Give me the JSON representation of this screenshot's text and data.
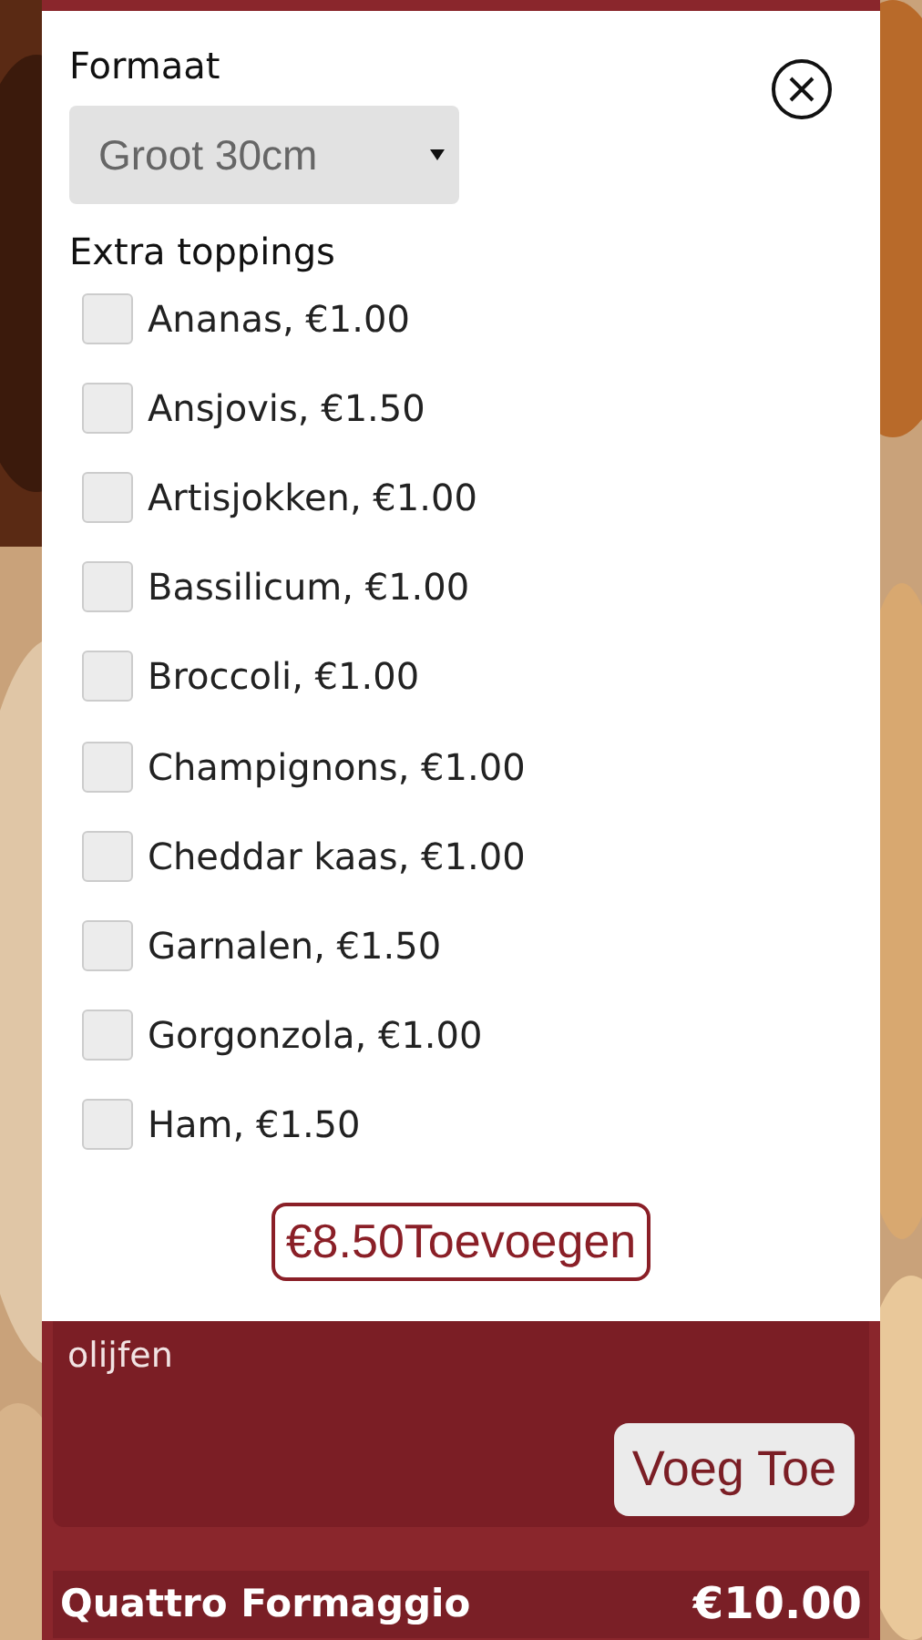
{
  "modal": {
    "size_label": "Formaat",
    "size_select": {
      "value": "Groot 30cm"
    },
    "toppings_label": "Extra toppings",
    "toppings": [
      {
        "label": "Ananas, €1.00",
        "checked": false
      },
      {
        "label": "Ansjovis, €1.50",
        "checked": false
      },
      {
        "label": "Artisjokken, €1.00",
        "checked": false
      },
      {
        "label": "Bassilicum, €1.00",
        "checked": false
      },
      {
        "label": "Broccoli, €1.00",
        "checked": false
      },
      {
        "label": "Champignons, €1.00",
        "checked": false
      },
      {
        "label": "Cheddar kaas, €1.00",
        "checked": false
      },
      {
        "label": "Garnalen, €1.50",
        "checked": false
      },
      {
        "label": "Gorgonzola, €1.00",
        "checked": false
      },
      {
        "label": "Ham, €1.50",
        "checked": false
      }
    ],
    "add_button": "€8.50Toevoegen"
  },
  "menu_item": {
    "description_tail": "olijfen",
    "add_button": "Voeg Toe"
  },
  "next_item": {
    "name": "Quattro Formaggio",
    "price": "€10.00"
  }
}
